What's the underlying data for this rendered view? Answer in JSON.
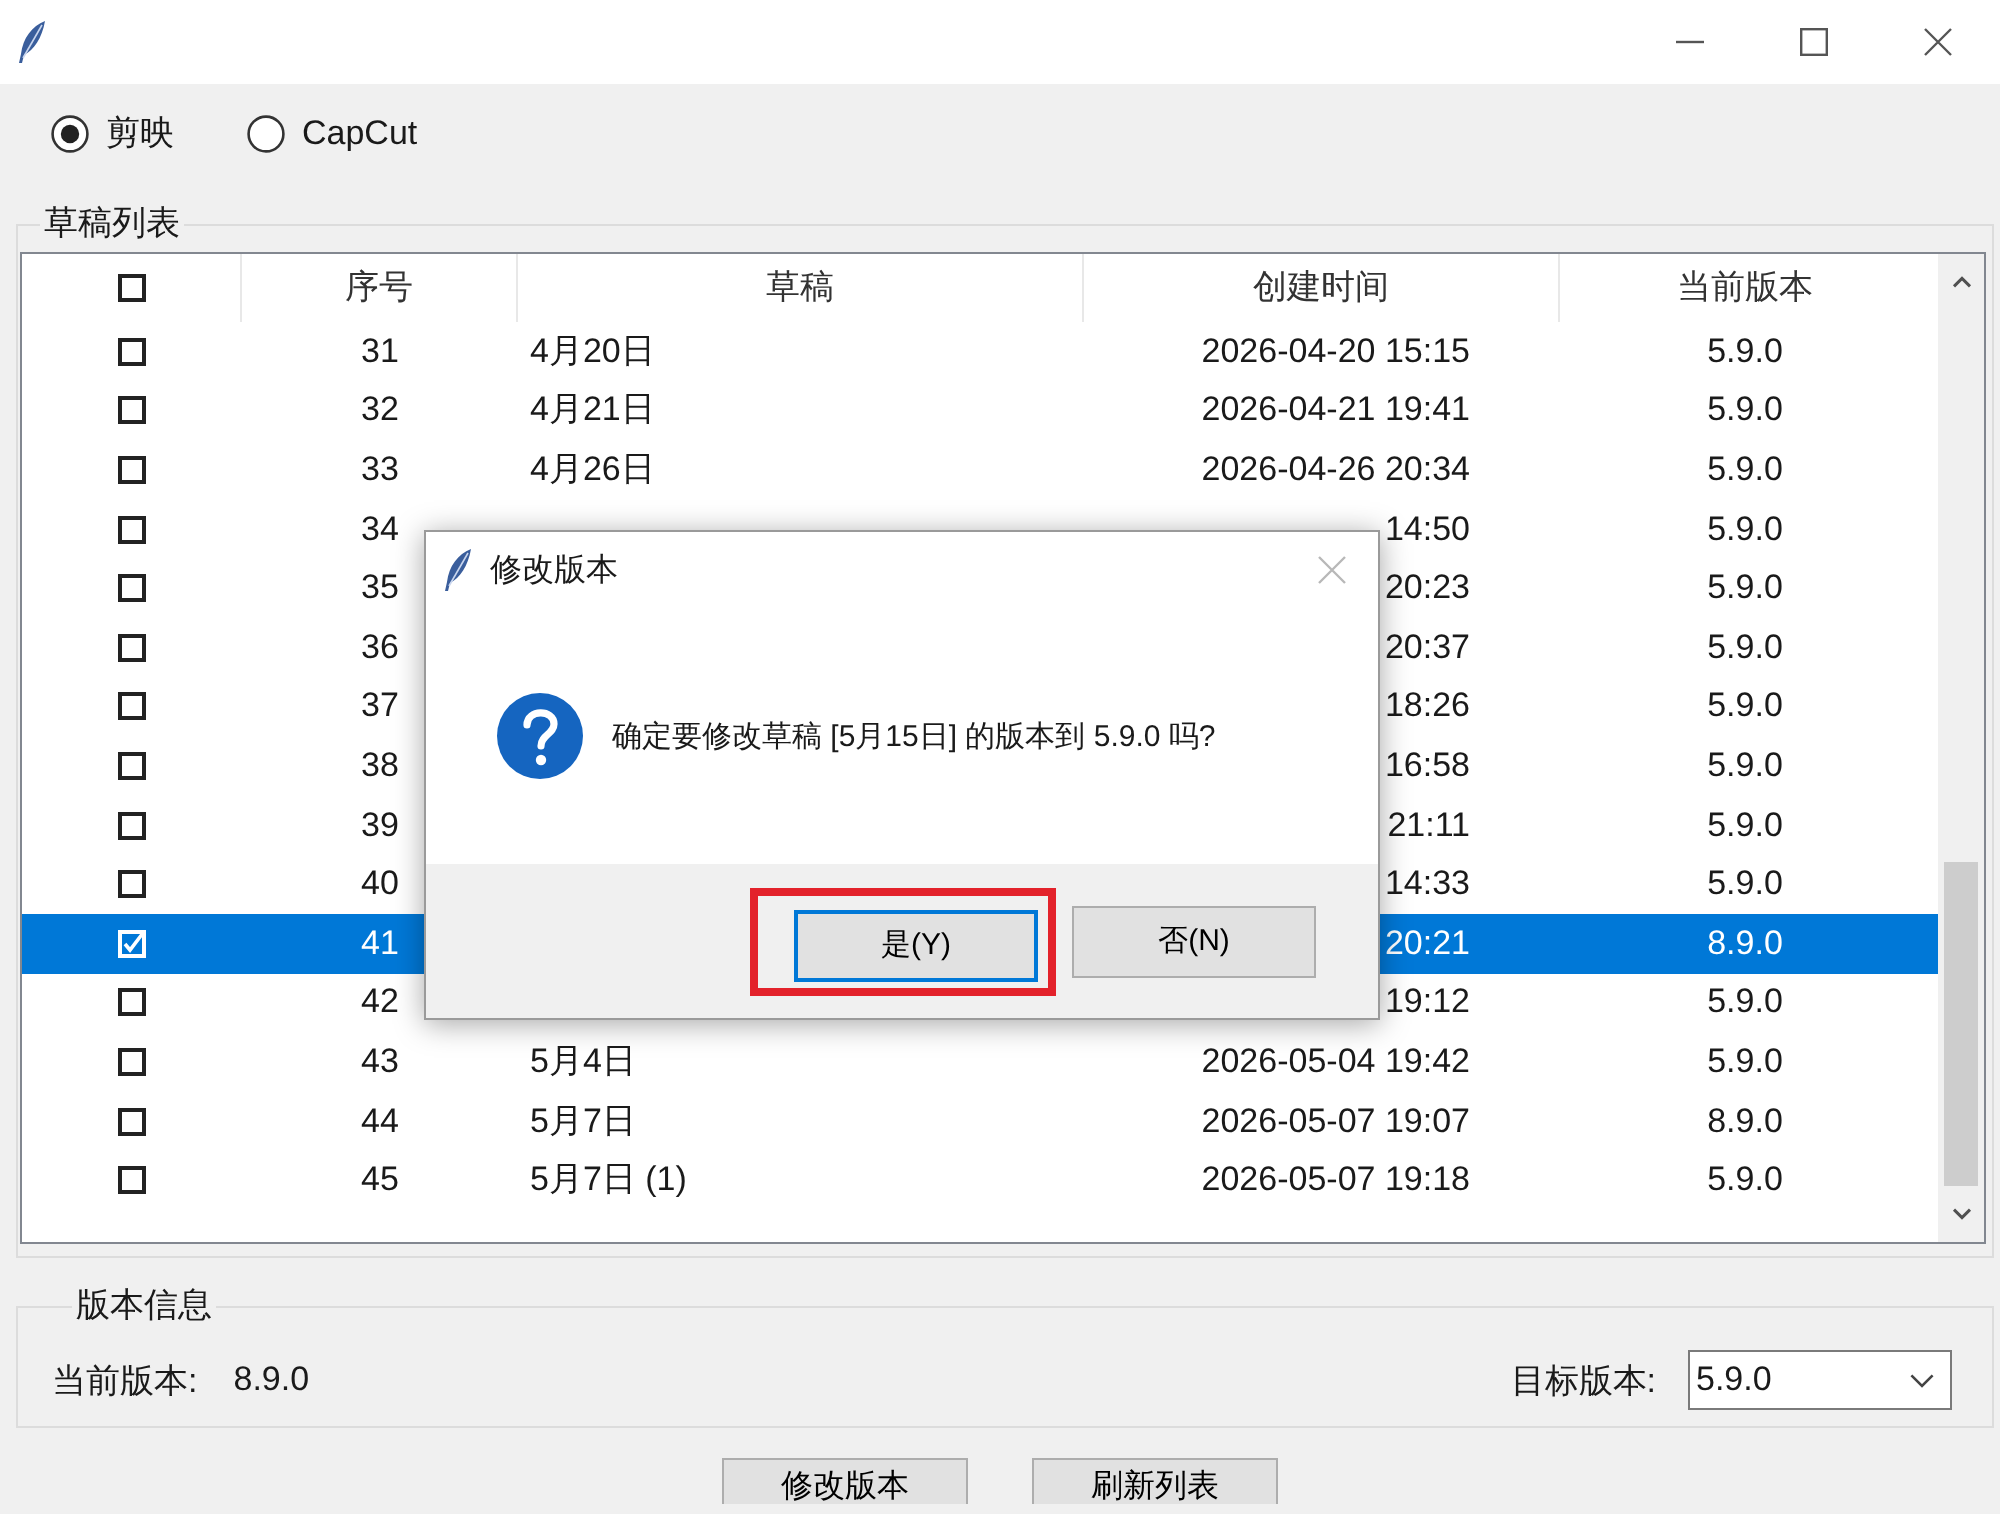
{
  "source_options": [
    {
      "label": "剪映",
      "selected": true
    },
    {
      "label": "CapCut",
      "selected": false
    }
  ],
  "draft_list": {
    "title": "草稿列表",
    "header_checkbox": {
      "checked": false
    },
    "columns": [
      "序号",
      "草稿",
      "创建时间",
      "当前版本"
    ],
    "rows": [
      {
        "checked": false,
        "selected": false,
        "number": "31",
        "draft": "4月20日",
        "created": "2026-04-20 15:15",
        "version": "5.9.0"
      },
      {
        "checked": false,
        "selected": false,
        "number": "32",
        "draft": "4月21日",
        "created": "2026-04-21 19:41",
        "version": "5.9.0"
      },
      {
        "checked": false,
        "selected": false,
        "number": "33",
        "draft": "4月26日",
        "created": "2026-04-26 20:34",
        "version": "5.9.0"
      },
      {
        "checked": false,
        "selected": false,
        "number": "34",
        "created": "14:50",
        "version": "5.9.0"
      },
      {
        "checked": false,
        "selected": false,
        "number": "35",
        "created": "20:23",
        "version": "5.9.0"
      },
      {
        "checked": false,
        "selected": false,
        "number": "36",
        "created": "20:37",
        "version": "5.9.0"
      },
      {
        "checked": false,
        "selected": false,
        "number": "37",
        "created": "18:26",
        "version": "5.9.0"
      },
      {
        "checked": false,
        "selected": false,
        "number": "38",
        "created": "16:58",
        "version": "5.9.0"
      },
      {
        "checked": false,
        "selected": false,
        "number": "39",
        "created": "21:11",
        "version": "5.9.0"
      },
      {
        "checked": false,
        "selected": false,
        "number": "40",
        "created": "14:33",
        "version": "5.9.0"
      },
      {
        "checked": true,
        "selected": true,
        "number": "41",
        "created": "20:21",
        "version": "8.9.0"
      },
      {
        "checked": false,
        "selected": false,
        "number": "42",
        "created": "19:12",
        "version": "5.9.0"
      },
      {
        "checked": false,
        "selected": false,
        "number": "43",
        "draft": "5月4日",
        "created": "2026-05-04 19:42",
        "version": "5.9.0"
      },
      {
        "checked": false,
        "selected": false,
        "number": "44",
        "draft": "5月7日",
        "created": "2026-05-07 19:07",
        "version": "8.9.0"
      },
      {
        "checked": false,
        "selected": false,
        "number": "45",
        "draft": "5月7日 (1)",
        "created": "2026-05-07 19:18",
        "version": "5.9.0"
      }
    ]
  },
  "version_info": {
    "title": "版本信息",
    "current_label": "当前版本:",
    "current_value": "8.9.0",
    "target_label": "目标版本:",
    "target_value": "5.9.0"
  },
  "buttons": [
    {
      "label": "修改版本"
    },
    {
      "label": "刷新列表"
    }
  ],
  "dialog": {
    "title": "修改版本",
    "message": "确定要修改草稿 [5月15日] 的版本到 5.9.0 吗?",
    "buttons": [
      {
        "label": "是(Y)",
        "focused": true,
        "highlighted": true
      },
      {
        "label": "否(N)",
        "focused": false,
        "highlighted": false
      }
    ]
  }
}
